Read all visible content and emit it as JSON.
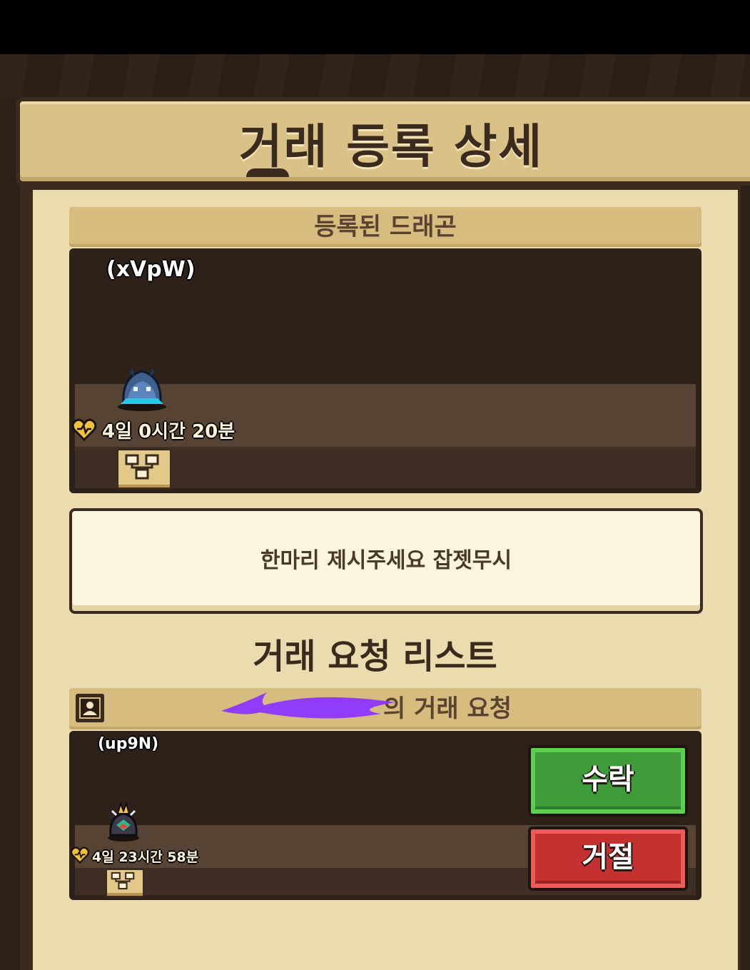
{
  "title": "거래 등록 상세",
  "registered": {
    "header": "등록된 드래곤",
    "dragon_name": "(xVpW)",
    "timer": "4일 0시간 20분"
  },
  "message": "한마리 제시주세요 잡젯무시",
  "request_list": {
    "title": "거래 요청 리스트",
    "request_header": "의 거래 요청",
    "dragon_name": "(up9N)",
    "timer": "4일 23시간 58분",
    "accept_label": "수락",
    "reject_label": "거절"
  },
  "colors": {
    "accept": "#3f9a3a",
    "reject": "#c53030",
    "panel": "#eadcaf"
  }
}
